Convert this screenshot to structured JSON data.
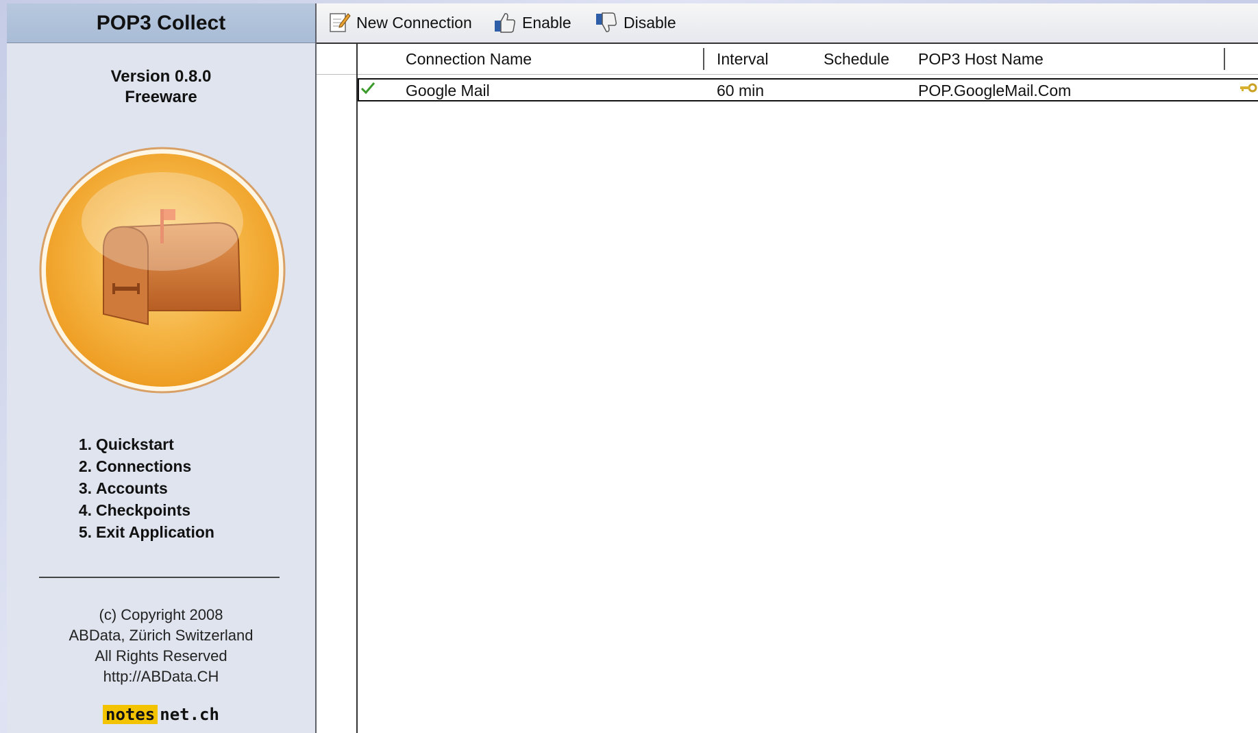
{
  "sidebar": {
    "title": "POP3 Collect",
    "version": "Version 0.8.0",
    "license": "Freeware",
    "logo_icon": "mailbox-icon",
    "nav": [
      {
        "num": "1.",
        "label": "Quickstart"
      },
      {
        "num": "2.",
        "label": "Connections"
      },
      {
        "num": "3.",
        "label": "Accounts"
      },
      {
        "num": "4.",
        "label": "Checkpoints"
      },
      {
        "num": "5.",
        "label": "Exit Application"
      }
    ],
    "copyright": {
      "line1": "(c) Copyright 2008",
      "line2": "ABData, Zürich Switzerland",
      "line3": "All Rights Reserved",
      "line4": "http://ABData.CH"
    },
    "badge": {
      "part1": "notes",
      "part2": "net.ch"
    }
  },
  "toolbar": {
    "new_connection": "New Connection",
    "enable": "Enable",
    "disable": "Disable"
  },
  "table": {
    "columns": [
      "Connection Name",
      "Interval",
      "Schedule",
      "POP3 Host Name"
    ],
    "rows": [
      {
        "status_icon": "checkmark-icon",
        "connection_name": "Google Mail",
        "interval": "60 min",
        "schedule": "",
        "host": "POP.GoogleMail.Com",
        "trailing_icon": "key-icon"
      }
    ]
  },
  "colors": {
    "sidebar_bg": "#dfe4ef",
    "header_bg": "#afc1d9",
    "logo_orange": "#f2a52a",
    "badge_yellow": "#f4c300"
  }
}
